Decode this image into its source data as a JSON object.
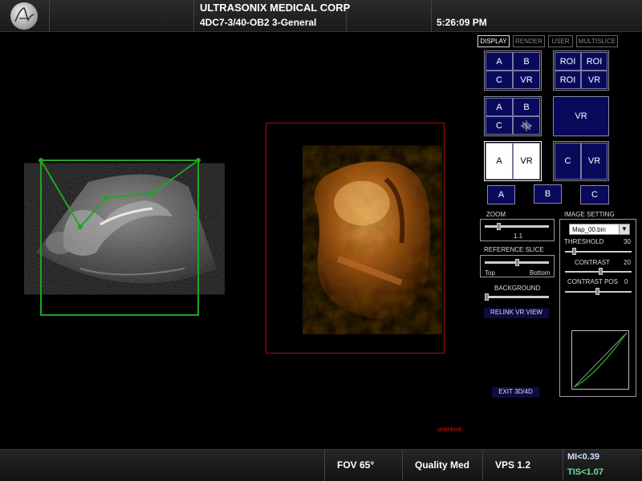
{
  "header": {
    "company": "ULTRASONIX MEDICAL CORP",
    "probe_preset": "4DC7-3/40-OB2 3-General",
    "time": "5:26:09 PM",
    "logo_icon": "ultrasonix-logo-icon"
  },
  "tabs": [
    {
      "label": "DISPLAY",
      "active": true
    },
    {
      "label": "RENDER",
      "active": false
    },
    {
      "label": "USER",
      "active": false
    },
    {
      "label": "MULTISLICE",
      "active": false
    }
  ],
  "layouts": {
    "quad_abc_vr": {
      "a": "A",
      "b": "B",
      "c": "C",
      "vr": "VR"
    },
    "quad_roi_vr": {
      "roi1": "ROI",
      "roi2": "ROI",
      "roi3": "ROI",
      "vr": "VR"
    },
    "quad_abc_tri": {
      "a": "A",
      "b": "B",
      "c": "C",
      "icon": "triplanar-icon"
    },
    "single_vr": {
      "vr": "VR"
    },
    "dual_a_vr": {
      "a": "A",
      "vr": "VR"
    },
    "dual_c_vr": {
      "c": "C",
      "vr": "VR"
    },
    "single_a": "A",
    "single_b": "B",
    "single_c": "C"
  },
  "controls": {
    "zoom_label": "ZOOM",
    "zoom_value": "1.1",
    "zoom_level": 0.2,
    "reference_slice_label": "REFERENCE SLICE",
    "ref_top": "Top",
    "ref_bottom": "Bottom",
    "ref_level": 0.5,
    "background_label": "BACKGROUND",
    "background_level": 0.0,
    "relink_label": "RELINK VR VIEW",
    "exit_label": "EXIT 3D/4D",
    "unlinked_text": "unlinked"
  },
  "image_setting": {
    "title": "IMAGE SETTING",
    "map_value": "Map_00.bin",
    "threshold_label": "THRESHOLD",
    "threshold_value": "30",
    "contrast_label": "CONTRAST",
    "contrast_value": "20",
    "contrast_pos_label": "CONTRAST POS",
    "contrast_pos_value": "0"
  },
  "footer": {
    "fov": "FOV 65°",
    "quality": "Quality Med",
    "vps": "VPS 1.2",
    "mi": "MI<0.39",
    "tis": "TIS<1.07"
  },
  "colors": {
    "roi_green": "#1fa61f",
    "vr_frame": "#a01010",
    "button_blue": "#0a0a5c",
    "unlinked_red": "#d01818"
  }
}
